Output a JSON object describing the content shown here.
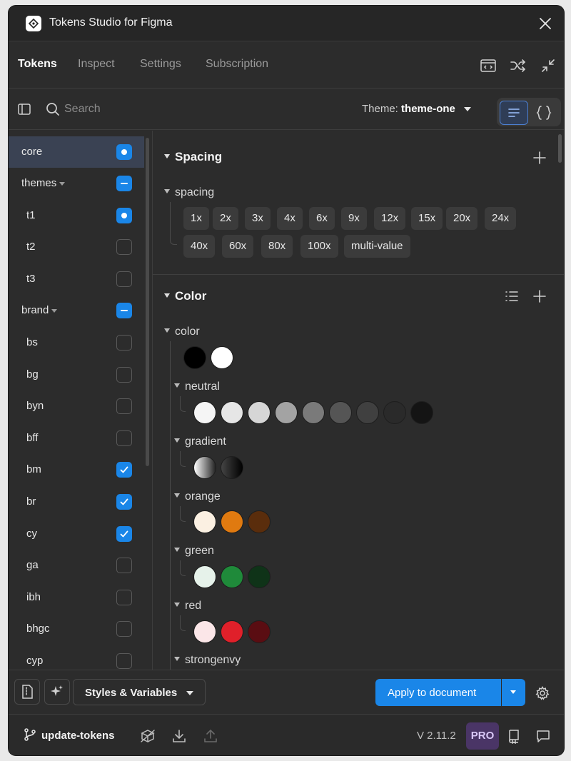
{
  "window": {
    "title": "Tokens Studio for Figma"
  },
  "tabs": [
    {
      "label": "Tokens",
      "active": true
    },
    {
      "label": "Inspect"
    },
    {
      "label": "Settings"
    },
    {
      "label": "Subscription"
    }
  ],
  "toolbar": {
    "search_placeholder": "Search",
    "theme_label": "Theme:",
    "theme_value": "theme-one"
  },
  "sidebar": {
    "items": [
      {
        "label": "core",
        "state": "on-dot",
        "selected": true
      },
      {
        "label": "themes",
        "state": "partial",
        "group": true
      },
      {
        "label": "t1",
        "state": "on-dot"
      },
      {
        "label": "t2",
        "state": "off"
      },
      {
        "label": "t3",
        "state": "off"
      },
      {
        "label": "brand",
        "state": "partial",
        "group": true
      },
      {
        "label": "bs",
        "state": "off"
      },
      {
        "label": "bg",
        "state": "off"
      },
      {
        "label": "byn",
        "state": "off"
      },
      {
        "label": "bff",
        "state": "off"
      },
      {
        "label": "bm",
        "state": "checked"
      },
      {
        "label": "br",
        "state": "checked"
      },
      {
        "label": "cy",
        "state": "checked"
      },
      {
        "label": "ga",
        "state": "off"
      },
      {
        "label": "ibh",
        "state": "off"
      },
      {
        "label": "bhgc",
        "state": "off"
      },
      {
        "label": "cyp",
        "state": "off"
      }
    ]
  },
  "main": {
    "spacing": {
      "title": "Spacing",
      "group": "spacing",
      "tokens_row1": [
        "1x",
        "2x",
        "3x",
        "4x",
        "6x",
        "9x",
        "12x",
        "15x",
        "20x",
        "24x"
      ],
      "tokens_row2": [
        "40x",
        "60x",
        "80x",
        "100x",
        "multi-value"
      ]
    },
    "color": {
      "title": "Color",
      "group": "color",
      "base_swatches": [
        "#000000",
        "#ffffff"
      ],
      "groups": [
        {
          "name": "neutral",
          "swatches": [
            "#f5f5f5",
            "#e6e6e6",
            "#d6d6d6",
            "#a3a3a3",
            "#7a7a7a",
            "#555555",
            "#404040",
            "#2a2a2a",
            "#141414"
          ]
        },
        {
          "name": "gradient",
          "swatches": [
            "linear-gradient(90deg,#ffffff,#222222)",
            "linear-gradient(90deg,#444444,#000000)"
          ]
        },
        {
          "name": "orange",
          "swatches": [
            "#fbf0e2",
            "#e07a10",
            "#5a2d0c"
          ]
        },
        {
          "name": "green",
          "swatches": [
            "#e6f2ea",
            "#1f8a3a",
            "#0f3318"
          ]
        },
        {
          "name": "red",
          "swatches": [
            "#fbe6e8",
            "#e0202a",
            "#5a0d12"
          ]
        },
        {
          "name": "strongenvy",
          "swatches": []
        }
      ]
    }
  },
  "footer": {
    "styles_label": "Styles & Variables",
    "apply_label": "Apply to document",
    "branch": "update-tokens",
    "version": "V 2.11.2",
    "pro_badge": "PRO"
  },
  "colors": {
    "accent": "#1a86e8",
    "background": "#2c2c2c",
    "pro": "#4a3566"
  }
}
